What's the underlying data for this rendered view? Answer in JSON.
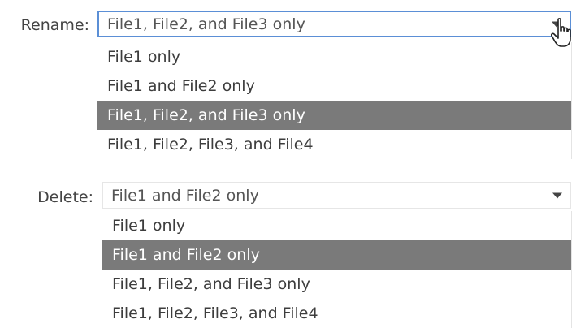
{
  "rename": {
    "label": "Rename:",
    "selected": "File1, File2, and File3 only",
    "options": [
      "File1 only",
      "File1 and File2 only",
      "File1, File2, and File3 only",
      "File1, File2, File3, and File4"
    ],
    "selected_index": 2
  },
  "delete": {
    "label": "Delete:",
    "selected": "File1 and File2 only",
    "options": [
      "File1 only",
      "File1 and File2 only",
      "File1, File2, and File3 only",
      "File1, File2, File3, and File4"
    ],
    "selected_index": 1
  },
  "colors": {
    "highlight": "#7a7a7a",
    "focus_border": "#5b8fd6"
  },
  "icons": {
    "cursor": "hand-pointer-icon",
    "dropdown": "chevron-down-icon"
  }
}
